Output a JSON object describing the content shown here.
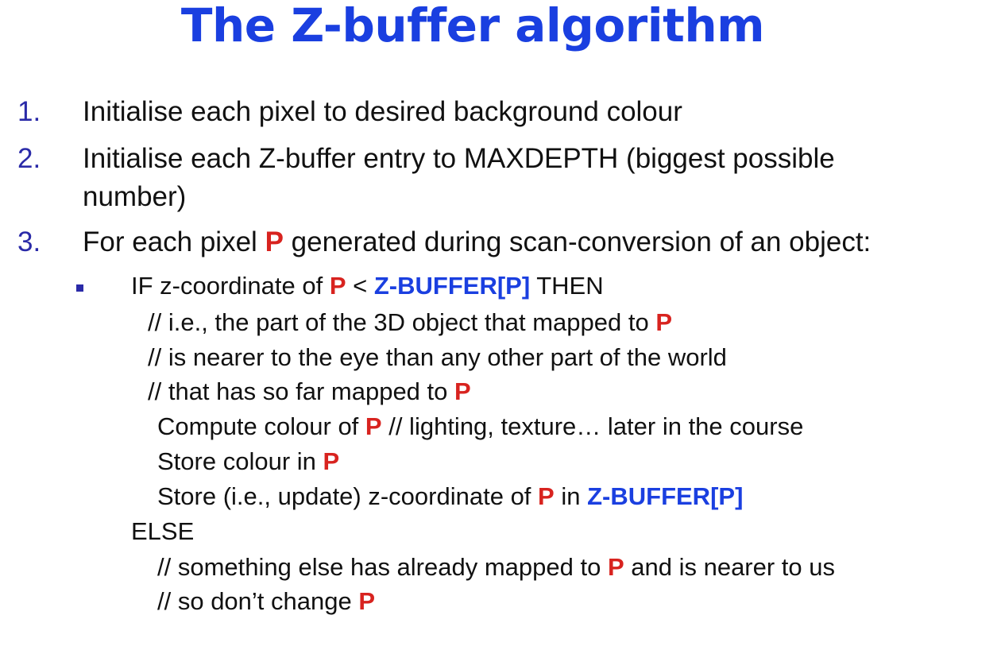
{
  "title": "The Z-buffer algorithm",
  "steps": [
    {
      "number": "1.",
      "text": "Initialise each pixel to desired background colour"
    },
    {
      "number": "2.",
      "line1": "Initialise each Z-buffer entry to MAXDEPTH (biggest possible",
      "line2": "number)"
    },
    {
      "number": "3.",
      "before": "For each pixel ",
      "marker": "P",
      "after": " generated during scan-conversion of an object:"
    }
  ],
  "pseudo": {
    "if_prefix": "IF z-coordinate of ",
    "lt": " < ",
    "zbuffer": "Z-BUFFER[P]",
    "then": " THEN",
    "c1": "// i.e., the part of the 3D object that mapped to ",
    "c2": "// is nearer to the eye than any other part of the world",
    "c3": "// that has so far mapped to ",
    "compute_prefix": "Compute colour of ",
    "compute_suffix": " // lighting, texture… later in the course",
    "store_colour": "Store colour in ",
    "store_z_prefix": "Store (i.e., update) z-coordinate of ",
    "store_z_mid": " in ",
    "else": "ELSE",
    "e1_prefix": "// something else has already mapped to ",
    "e1_suffix": " and is nearer to us",
    "e2": "// so don’t change "
  },
  "marker": "P",
  "colors": {
    "title": "#1a3fe0",
    "marker": "#d8231f",
    "zbuffer": "#1a3fe0",
    "numbers": "#2a2aa8"
  }
}
